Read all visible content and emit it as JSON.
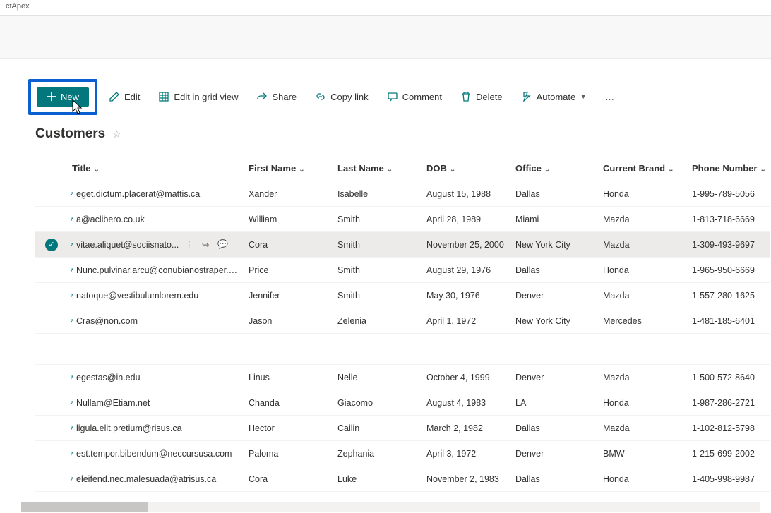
{
  "browserTab": "ctApex",
  "toolbar": {
    "new": "New",
    "edit": "Edit",
    "gridView": "Edit in grid view",
    "share": "Share",
    "copyLink": "Copy link",
    "comment": "Comment",
    "delete": "Delete",
    "automate": "Automate"
  },
  "listTitle": "Customers",
  "columns": {
    "title": "Title",
    "firstName": "First Name",
    "lastName": "Last Name",
    "dob": "DOB",
    "office": "Office",
    "brand": "Current Brand",
    "phone": "Phone Number"
  },
  "rows": [
    {
      "title": "eget.dictum.placerat@mattis.ca",
      "first": "Xander",
      "last": "Isabelle",
      "dob": "August 15, 1988",
      "office": "Dallas",
      "brand": "Honda",
      "phone": "1-995-789-5056"
    },
    {
      "title": "a@aclibero.co.uk",
      "first": "William",
      "last": "Smith",
      "dob": "April 28, 1989",
      "office": "Miami",
      "brand": "Mazda",
      "phone": "1-813-718-6669"
    },
    {
      "title": "vitae.aliquet@sociisnato...",
      "first": "Cora",
      "last": "Smith",
      "dob": "November 25, 2000",
      "office": "New York City",
      "brand": "Mazda",
      "phone": "1-309-493-9697",
      "selected": true
    },
    {
      "title": "Nunc.pulvinar.arcu@conubianostraper.edu",
      "first": "Price",
      "last": "Smith",
      "dob": "August 29, 1976",
      "office": "Dallas",
      "brand": "Honda",
      "phone": "1-965-950-6669"
    },
    {
      "title": "natoque@vestibulumlorem.edu",
      "first": "Jennifer",
      "last": "Smith",
      "dob": "May 30, 1976",
      "office": "Denver",
      "brand": "Mazda",
      "phone": "1-557-280-1625"
    },
    {
      "title": "Cras@non.com",
      "first": "Jason",
      "last": "Zelenia",
      "dob": "April 1, 1972",
      "office": "New York City",
      "brand": "Mercedes",
      "phone": "1-481-185-6401"
    },
    {
      "spacer": true
    },
    {
      "title": "egestas@in.edu",
      "first": "Linus",
      "last": "Nelle",
      "dob": "October 4, 1999",
      "office": "Denver",
      "brand": "Mazda",
      "phone": "1-500-572-8640"
    },
    {
      "title": "Nullam@Etiam.net",
      "first": "Chanda",
      "last": "Giacomo",
      "dob": "August 4, 1983",
      "office": "LA",
      "brand": "Honda",
      "phone": "1-987-286-2721"
    },
    {
      "title": "ligula.elit.pretium@risus.ca",
      "first": "Hector",
      "last": "Cailin",
      "dob": "March 2, 1982",
      "office": "Dallas",
      "brand": "Mazda",
      "phone": "1-102-812-5798"
    },
    {
      "title": "est.tempor.bibendum@neccursusa.com",
      "first": "Paloma",
      "last": "Zephania",
      "dob": "April 3, 1972",
      "office": "Denver",
      "brand": "BMW",
      "phone": "1-215-699-2002"
    },
    {
      "title": "eleifend.nec.malesuada@atrisus.ca",
      "first": "Cora",
      "last": "Luke",
      "dob": "November 2, 1983",
      "office": "Dallas",
      "brand": "Honda",
      "phone": "1-405-998-9987"
    }
  ]
}
